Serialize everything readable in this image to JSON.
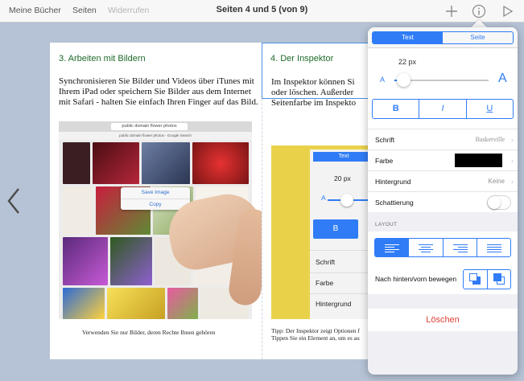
{
  "topbar": {
    "my_books": "Meine Bücher",
    "pages": "Seiten",
    "undo": "Widerrufen",
    "title": "Seiten 4 und 5 (von 9)",
    "icons": [
      "plus-icon",
      "info-icon",
      "play-icon"
    ]
  },
  "left_page": {
    "heading": "3. Arbeiten mit Bildern",
    "body": "Synchronisieren Sie Bilder und Videos über iTunes mit Ihrem iPad oder speichern Sie Bilder aus dem Internet mit Safari - halten Sie einfach Ihren Finger auf das Bild.",
    "caption": "Verwenden Sie nur Bilder, deren Rechte Ihnen gehören",
    "screenshot": {
      "url": "public domain flower photos",
      "subtitle": "public domain flower photos - Google Search",
      "menu_save": "Save Image",
      "menu_copy": "Copy"
    }
  },
  "right_page": {
    "heading": "4. Der Inspektor",
    "body_line1": "Im Inspektor können Si",
    "body_line2": "oder löschen. Außerder",
    "body_line3": "Seitenfarbe im Inspekto",
    "caption_line1": "Tipp: Der Inspektor zeigt Optionen f",
    "caption_line2": "Tippen Sie ein Element an, um es au",
    "screenshot": {
      "tab": "Text",
      "size": "20 px",
      "a": "A",
      "bold": "B",
      "font": "Schrift",
      "color": "Farbe",
      "background": "Hintergrund"
    }
  },
  "inspector": {
    "tabs": [
      {
        "label": "Text",
        "active": true
      },
      {
        "label": "Seite",
        "active": false
      }
    ],
    "font_size": "22 px",
    "slider_small": "A",
    "slider_large": "A",
    "font_size_fraction": 0.1,
    "format": [
      "B",
      "I",
      "U"
    ],
    "rows": {
      "font_label": "Schrift",
      "font_value": "Baskerville",
      "color_label": "Farbe",
      "color_value": "#000000",
      "background_label": "Hintergrund",
      "background_value": "Keine",
      "shadow_label": "Schattierung",
      "shadow_on": false
    },
    "layout_label": "LAYOUT",
    "order_label": "Nach hinten/vorn bewegen",
    "delete_label": "Löschen",
    "accent": "#2f7cf6",
    "danger": "#e0413a"
  }
}
